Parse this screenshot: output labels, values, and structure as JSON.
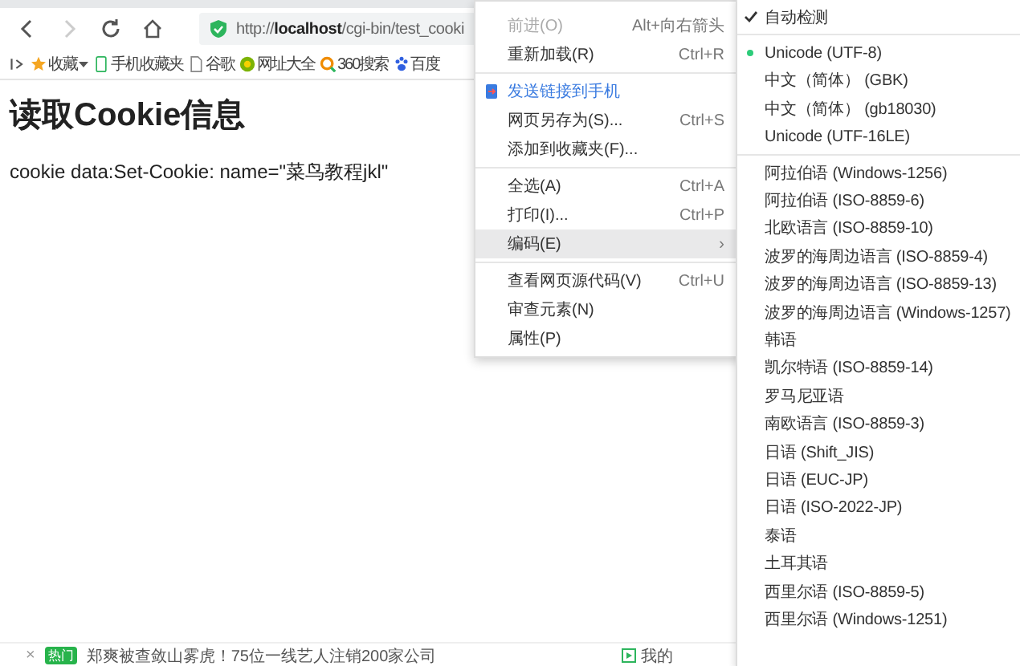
{
  "toolbar": {
    "back_disabled": false,
    "forward_disabled": true,
    "url": "http://**localhost**/cgi-bin/test_cooki"
  },
  "bookmarks": [
    {
      "kind": "star",
      "label": "收藏",
      "dropdown": true
    },
    {
      "kind": "phone",
      "label": "手机收藏夹",
      "dropdown": false
    },
    {
      "kind": "page",
      "label": "谷歌",
      "dropdown": false
    },
    {
      "kind": "globe",
      "label": "网址大全",
      "dropdown": false
    },
    {
      "kind": "search",
      "label": "360搜索",
      "dropdown": false
    },
    {
      "kind": "paw",
      "label": "百度",
      "dropdown": false
    }
  ],
  "page": {
    "heading": "读取Cookie信息",
    "text": "cookie data:Set-Cookie: name=\"菜鸟教程jkl\""
  },
  "context_menu": {
    "groups": [
      [
        {
          "kind": "item",
          "label": "前进(O)",
          "shortcut": "Alt+向右箭头",
          "disabled": true,
          "selected": false
        },
        {
          "kind": "item",
          "label": "重新加载(R)",
          "shortcut": "Ctrl+R",
          "disabled": false,
          "selected": false
        }
      ],
      [
        {
          "kind": "send",
          "label": "发送链接到手机",
          "disabled": false,
          "selected": false
        },
        {
          "kind": "item",
          "label": "网页另存为(S)...",
          "shortcut": "Ctrl+S",
          "disabled": false,
          "selected": false
        },
        {
          "kind": "item",
          "label": "添加到收藏夹(F)...",
          "disabled": false,
          "selected": false
        }
      ],
      [
        {
          "kind": "item",
          "label": "全选(A)",
          "shortcut": "Ctrl+A",
          "disabled": false,
          "selected": false
        },
        {
          "kind": "item",
          "label": "打印(I)...",
          "shortcut": "Ctrl+P",
          "disabled": false,
          "selected": false
        },
        {
          "kind": "submenu",
          "label": "编码(E)",
          "shortcut": "›",
          "disabled": false,
          "selected": true
        }
      ],
      [
        {
          "kind": "item",
          "label": "查看网页源代码(V)",
          "shortcut": "Ctrl+U",
          "disabled": false,
          "selected": false
        },
        {
          "kind": "item",
          "label": "审查元素(N)",
          "disabled": false,
          "selected": false
        },
        {
          "kind": "item",
          "label": "属性(P)",
          "disabled": false,
          "selected": false
        }
      ]
    ]
  },
  "encoding_menu": {
    "auto_detect": {
      "label": "自动检测",
      "checked": true
    },
    "groups": [
      [
        {
          "label": "Unicode (UTF-8)",
          "selected": true
        },
        {
          "label": "中文（简体） (GBK)",
          "selected": false
        },
        {
          "label": "中文（简体） (gb18030)",
          "selected": false
        },
        {
          "label": "Unicode (UTF-16LE)",
          "selected": false
        }
      ],
      [
        {
          "label": "阿拉伯语 (Windows-1256)",
          "selected": false
        },
        {
          "label": "阿拉伯语 (ISO-8859-6)",
          "selected": false
        },
        {
          "label": "北欧语言 (ISO-8859-10)",
          "selected": false
        },
        {
          "label": "波罗的海周边语言 (ISO-8859-4)",
          "selected": false
        },
        {
          "label": "波罗的海周边语言 (ISO-8859-13)",
          "selected": false
        },
        {
          "label": "波罗的海周边语言 (Windows-1257)",
          "selected": false
        },
        {
          "label": "韩语",
          "selected": false
        },
        {
          "label": "凯尔特语 (ISO-8859-14)",
          "selected": false
        },
        {
          "label": "罗马尼亚语",
          "selected": false
        },
        {
          "label": "南欧语言 (ISO-8859-3)",
          "selected": false
        },
        {
          "label": "日语 (Shift_JIS)",
          "selected": false
        },
        {
          "label": "日语 (EUC-JP)",
          "selected": false
        },
        {
          "label": "日语 (ISO-2022-JP)",
          "selected": false
        },
        {
          "label": "泰语",
          "selected": false
        },
        {
          "label": "土耳其语",
          "selected": false
        },
        {
          "label": "西里尔语 (ISO-8859-5)",
          "selected": false
        },
        {
          "label": "西里尔语 (Windows-1251)",
          "selected": false
        }
      ]
    ]
  },
  "news_bar": {
    "close": "×",
    "badge": "热门",
    "headline": "郑爽被查敛山雾虎！75位一线艺人注销200家公司",
    "right_label": "我的"
  }
}
